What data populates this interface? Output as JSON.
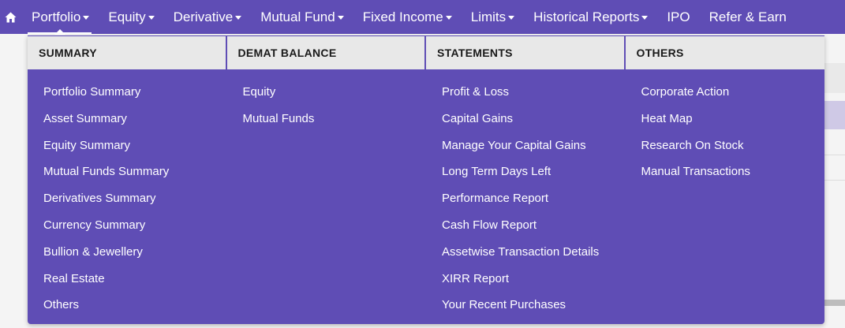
{
  "nav": {
    "home_icon": "home-icon",
    "items": [
      {
        "label": "Portfolio",
        "caret": true
      },
      {
        "label": "Equity",
        "caret": true
      },
      {
        "label": "Derivative",
        "caret": true
      },
      {
        "label": "Mutual Fund",
        "caret": true
      },
      {
        "label": "Fixed Income",
        "caret": true
      },
      {
        "label": "Limits",
        "caret": true
      },
      {
        "label": "Historical Reports",
        "caret": true
      },
      {
        "label": "IPO",
        "caret": false
      },
      {
        "label": "Refer & Earn",
        "caret": false
      }
    ],
    "active": "Portfolio"
  },
  "menu": {
    "columns": [
      {
        "heading": "SUMMARY",
        "items": [
          "Portfolio Summary",
          "Asset Summary",
          "Equity Summary",
          "Mutual Funds Summary",
          "Derivatives Summary",
          "Currency Summary",
          "Bullion & Jewellery",
          "Real Estate",
          "Others"
        ]
      },
      {
        "heading": "DEMAT BALANCE",
        "items": [
          "Equity",
          "Mutual Funds"
        ]
      },
      {
        "heading": "STATEMENTS",
        "items": [
          "Profit & Loss",
          "Capital Gains",
          "Manage Your Capital Gains",
          "Long Term Days Left",
          "Performance Report",
          "Cash Flow Report",
          "Assetwise Transaction Details",
          "XIRR Report",
          "Your Recent Purchases"
        ]
      },
      {
        "heading": "OTHERS",
        "items": [
          "Corporate Action",
          "Heat Map",
          "Research On Stock",
          "Manual Transactions"
        ]
      }
    ]
  },
  "colors": {
    "brand": "#5f4db5",
    "header_bg": "#e8e8e8",
    "text_light": "#ffffff"
  }
}
